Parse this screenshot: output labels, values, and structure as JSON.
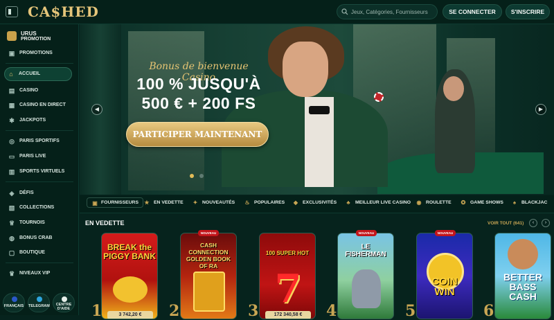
{
  "header": {
    "logo": "CA$HED",
    "search_placeholder": "Jeux, Catégories, Fournisseurs",
    "login_label": "SE CONNECTER",
    "signup_label": "S'INSCRIRE"
  },
  "sidebar": {
    "promo_title": "URUS",
    "promo_subtitle": "PROMOTION",
    "items": [
      {
        "label": "PROMOTIONS",
        "icon": "gift-icon"
      },
      {
        "label": "ACCUEIL",
        "icon": "home-icon",
        "active": true
      },
      {
        "label": "CASINO",
        "icon": "cards-icon"
      },
      {
        "label": "CASINO EN DIRECT",
        "icon": "live-icon"
      },
      {
        "label": "JACKPOTS",
        "icon": "jackpot-icon"
      },
      {
        "label": "PARIS SPORTIFS",
        "icon": "sports-icon"
      },
      {
        "label": "PARIS LIVE",
        "icon": "live-bet-icon"
      },
      {
        "label": "SPORTS VIRTUELS",
        "icon": "virtual-sports-icon"
      },
      {
        "label": "DÉFIS",
        "icon": "challenge-icon"
      },
      {
        "label": "COLLECTIONS",
        "icon": "collection-icon"
      },
      {
        "label": "TOURNOIS",
        "icon": "trophy-icon"
      },
      {
        "label": "BONUS CRAB",
        "icon": "crab-icon"
      },
      {
        "label": "BOUTIQUE",
        "icon": "shop-icon"
      },
      {
        "label": "NIVEAUX VIP",
        "icon": "vip-icon"
      }
    ],
    "bottom": [
      {
        "label": "FRANÇAIS",
        "icon": "flag-icon"
      },
      {
        "label": "TELEGRAM",
        "icon": "telegram-icon"
      },
      {
        "label": "CENTRE D'AIDE",
        "icon": "help-icon"
      }
    ]
  },
  "hero": {
    "tagline": "Bonus de bienvenue Casino",
    "line1": "100 % JUSQU'À",
    "line2": "500 € + 200 FS",
    "cta_label": "PARTICIPER MAINTENANT",
    "slides_total": 2,
    "slide_active": 1
  },
  "categories": [
    {
      "label": "FOURNISSEURS",
      "icon": "provider-icon"
    },
    {
      "label": "EN VEDETTE",
      "icon": "star-icon"
    },
    {
      "label": "NOUVEAUTÉS",
      "icon": "new-icon"
    },
    {
      "label": "POPULAIRES",
      "icon": "fire-icon"
    },
    {
      "label": "EXCLUSIVITÉS",
      "icon": "diamond-icon"
    },
    {
      "label": "MEILLEUR LIVE CASINO",
      "icon": "live-casino-icon"
    },
    {
      "label": "ROULETTE",
      "icon": "roulette-icon"
    },
    {
      "label": "GAME SHOWS",
      "icon": "gameshow-icon"
    },
    {
      "label": "BLACKJAC",
      "icon": "blackjack-icon"
    }
  ],
  "featured": {
    "title": "EN VEDETTE",
    "see_all": "VOIR TOUT (641)",
    "games": [
      {
        "rank": "1",
        "title": "BREAK the PIGGY BANK",
        "amount": "3 742,20 €",
        "new": false
      },
      {
        "rank": "2",
        "title": "CASH CONNECTION GOLDEN BOOK OF RA",
        "amount": "",
        "new": true,
        "badge": "NOUVEAU"
      },
      {
        "rank": "3",
        "title": "100 SUPER HOT",
        "amount": "172 340,58 €",
        "new": false
      },
      {
        "rank": "4",
        "title": "LE FISHERMAN",
        "amount": "",
        "new": true,
        "badge": "NOUVEAU"
      },
      {
        "rank": "5",
        "title": "COIN WIN",
        "amount": "",
        "new": true,
        "badge": "NOUVEAU"
      },
      {
        "rank": "6",
        "title": "BETTER BASS CASH",
        "amount": "",
        "new": false
      }
    ]
  }
}
